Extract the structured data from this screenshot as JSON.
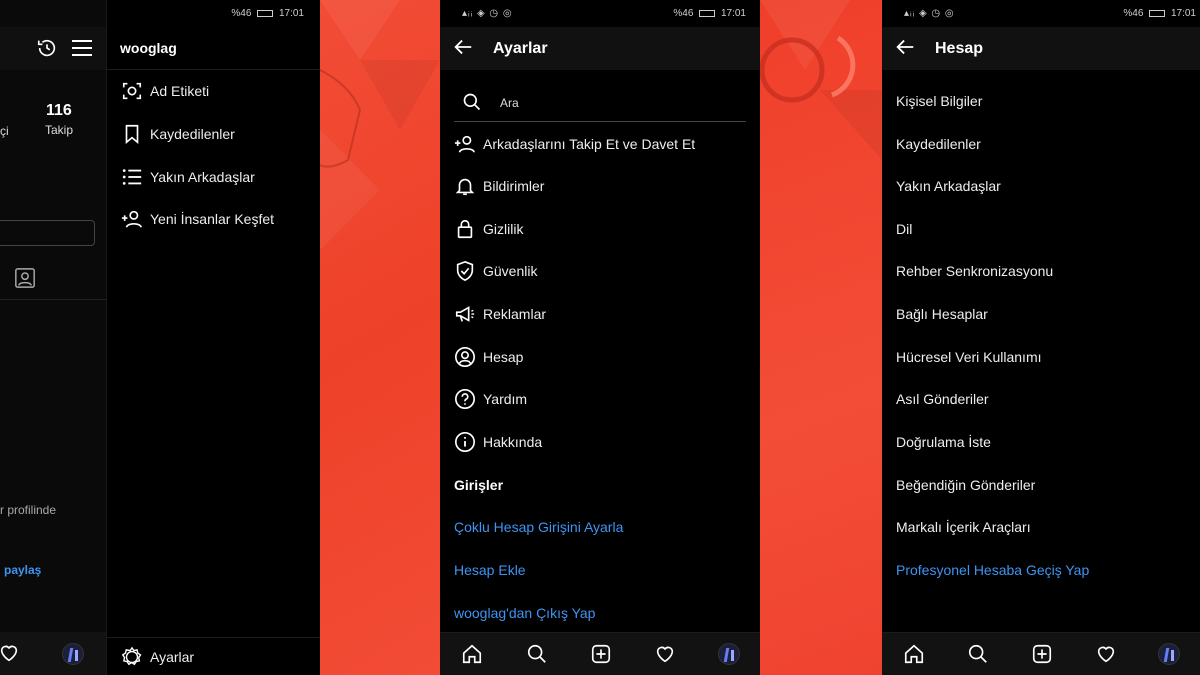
{
  "status": {
    "signal": "▴ᵢᵢ ◈ ◷ ◎",
    "battery": "%46",
    "time": "17:01"
  },
  "panel1": {
    "following_count": "116",
    "following_label": "Takip",
    "partial_left_label": "çi",
    "partial_profile_text": "r profilinde",
    "partial_share_link": "paylaş"
  },
  "drawer": {
    "username": "wooglag",
    "items": [
      {
        "label": "Ad Etiketi",
        "icon": "nametag-icon"
      },
      {
        "label": "Kaydedilenler",
        "icon": "bookmark-icon"
      },
      {
        "label": "Yakın Arkadaşlar",
        "icon": "list-icon"
      },
      {
        "label": "Yeni İnsanlar Keşfet",
        "icon": "add-person-icon"
      }
    ],
    "settings_label": "Ayarlar"
  },
  "settings": {
    "title": "Ayarlar",
    "search_placeholder": "Ara",
    "items": [
      {
        "label": "Arkadaşlarını Takip Et ve Davet Et",
        "icon": "add-person-icon"
      },
      {
        "label": "Bildirimler",
        "icon": "bell-icon"
      },
      {
        "label": "Gizlilik",
        "icon": "lock-icon"
      },
      {
        "label": "Güvenlik",
        "icon": "shield-icon"
      },
      {
        "label": "Reklamlar",
        "icon": "megaphone-icon"
      },
      {
        "label": "Hesap",
        "icon": "account-icon"
      },
      {
        "label": "Yardım",
        "icon": "help-icon"
      },
      {
        "label": "Hakkında",
        "icon": "info-icon"
      }
    ],
    "section_logins": "Girişler",
    "links": [
      "Çoklu Hesap Girişini Ayarla",
      "Hesap Ekle",
      "wooglag'dan Çıkış Yap"
    ]
  },
  "account": {
    "title": "Hesap",
    "items": [
      "Kişisel Bilgiler",
      "Kaydedilenler",
      "Yakın Arkadaşlar",
      "Dil",
      "Rehber Senkronizasyonu",
      "Bağlı Hesaplar",
      "Hücresel Veri Kullanımı",
      "Asıl Gönderiler",
      "Doğrulama İste",
      "Beğendiğin Gönderiler",
      "Markalı İçerik Araçları"
    ],
    "pro_link": "Profesyonel Hesaba Geçiş Yap"
  },
  "colors": {
    "accent_link": "#3e94f2",
    "background_red": "#f04530",
    "panel_black": "#000000"
  }
}
